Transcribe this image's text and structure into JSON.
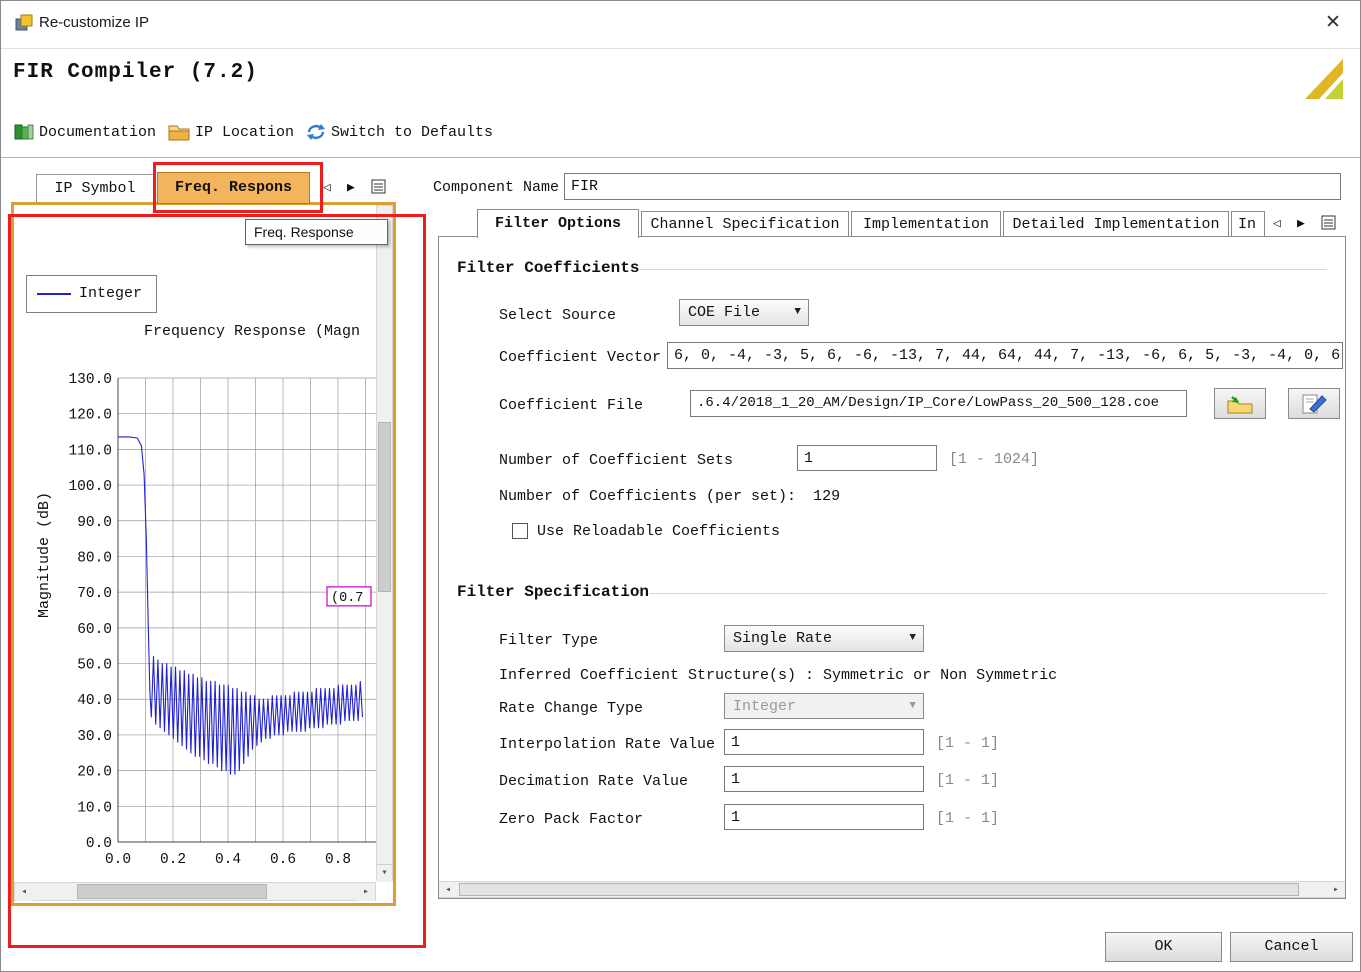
{
  "window": {
    "title": "Re-customize IP",
    "close_glyph": "✕"
  },
  "header": {
    "title": "FIR Compiler  (7.2)"
  },
  "toolbar": {
    "items": [
      {
        "label": "Documentation"
      },
      {
        "label": "IP Location"
      },
      {
        "label": "Switch to Defaults"
      }
    ]
  },
  "left_panel": {
    "tabs": [
      {
        "label": "IP Symbol",
        "selected": false
      },
      {
        "label": "Freq. Respons",
        "selected": true
      }
    ],
    "nav": {
      "prev": "◁",
      "next": "▶"
    },
    "tooltip": "Freq. Response",
    "chart_data": {
      "type": "line",
      "title": "Frequency Response (Magnitude)",
      "title_visible": "Frequency Response (Magn",
      "xlabel": "",
      "ylabel": "Magnitude (dB)",
      "legend": [
        "Integer"
      ],
      "legend_position": "top-left",
      "grid": true,
      "xlim": [
        0.0,
        0.91
      ],
      "ylim": [
        0.0,
        130.0
      ],
      "xticks": [
        0.0,
        0.2,
        0.4,
        0.6,
        0.8
      ],
      "yticks": [
        0,
        10,
        20,
        30,
        40,
        50,
        60,
        70,
        80,
        90,
        100,
        110,
        120,
        130
      ],
      "x_grid_step": 0.1,
      "annotation": {
        "text": "(0.7",
        "x": 0.76,
        "y": 67
      },
      "series": [
        {
          "name": "Integer",
          "color": "#2121d4",
          "points": [
            [
              0,
              113.5
            ],
            [
              0.04,
              113.5
            ],
            [
              0.07,
              113.2
            ],
            [
              0.085,
              111
            ],
            [
              0.095,
              103
            ],
            [
              0.103,
              85
            ],
            [
              0.11,
              60
            ],
            [
              0.116,
              42
            ],
            [
              0.121,
              35
            ],
            [
              0.129,
              52
            ],
            [
              0.137,
              33
            ],
            [
              0.145,
              51
            ],
            [
              0.153,
              32
            ],
            [
              0.161,
              50
            ],
            [
              0.169,
              31
            ],
            [
              0.177,
              50
            ],
            [
              0.185,
              30
            ],
            [
              0.193,
              49
            ],
            [
              0.201,
              29
            ],
            [
              0.209,
              49
            ],
            [
              0.217,
              28
            ],
            [
              0.225,
              48
            ],
            [
              0.233,
              27
            ],
            [
              0.241,
              48
            ],
            [
              0.249,
              26
            ],
            [
              0.257,
              47
            ],
            [
              0.265,
              25
            ],
            [
              0.273,
              47
            ],
            [
              0.281,
              24
            ],
            [
              0.289,
              46
            ],
            [
              0.297,
              24
            ],
            [
              0.305,
              46
            ],
            [
              0.313,
              23
            ],
            [
              0.321,
              45
            ],
            [
              0.329,
              22
            ],
            [
              0.337,
              45
            ],
            [
              0.345,
              22
            ],
            [
              0.353,
              45
            ],
            [
              0.361,
              21
            ],
            [
              0.369,
              44
            ],
            [
              0.377,
              20
            ],
            [
              0.385,
              44
            ],
            [
              0.393,
              20
            ],
            [
              0.401,
              44
            ],
            [
              0.409,
              19
            ],
            [
              0.417,
              43
            ],
            [
              0.425,
              19
            ],
            [
              0.433,
              43
            ],
            [
              0.441,
              20
            ],
            [
              0.449,
              42
            ],
            [
              0.457,
              22
            ],
            [
              0.465,
              42
            ],
            [
              0.473,
              24
            ],
            [
              0.481,
              41
            ],
            [
              0.489,
              26
            ],
            [
              0.497,
              41
            ],
            [
              0.505,
              27
            ],
            [
              0.513,
              40
            ],
            [
              0.521,
              28
            ],
            [
              0.529,
              40
            ],
            [
              0.537,
              29
            ],
            [
              0.545,
              40
            ],
            [
              0.553,
              29
            ],
            [
              0.561,
              41
            ],
            [
              0.569,
              30
            ],
            [
              0.577,
              41
            ],
            [
              0.585,
              30
            ],
            [
              0.593,
              41
            ],
            [
              0.601,
              30
            ],
            [
              0.609,
              41
            ],
            [
              0.617,
              31
            ],
            [
              0.625,
              41
            ],
            [
              0.633,
              31
            ],
            [
              0.641,
              42
            ],
            [
              0.649,
              31
            ],
            [
              0.657,
              42
            ],
            [
              0.665,
              31
            ],
            [
              0.673,
              42
            ],
            [
              0.681,
              31
            ],
            [
              0.689,
              42
            ],
            [
              0.697,
              32
            ],
            [
              0.705,
              42
            ],
            [
              0.713,
              32
            ],
            [
              0.721,
              43
            ],
            [
              0.729,
              32
            ],
            [
              0.737,
              43
            ],
            [
              0.745,
              32
            ],
            [
              0.753,
              43
            ],
            [
              0.761,
              33
            ],
            [
              0.769,
              43
            ],
            [
              0.777,
              33
            ],
            [
              0.785,
              43
            ],
            [
              0.793,
              33
            ],
            [
              0.801,
              44
            ],
            [
              0.809,
              33
            ],
            [
              0.817,
              44
            ],
            [
              0.825,
              34
            ],
            [
              0.833,
              44
            ],
            [
              0.841,
              34
            ],
            [
              0.849,
              44
            ],
            [
              0.857,
              34
            ],
            [
              0.865,
              44
            ],
            [
              0.873,
              34
            ],
            [
              0.881,
              45
            ],
            [
              0.889,
              35
            ]
          ]
        }
      ]
    }
  },
  "component": {
    "label": "Component Name",
    "value": "FIR"
  },
  "right_tabs": [
    {
      "label": "Filter Options",
      "selected": true
    },
    {
      "label": "Channel Specification",
      "selected": false
    },
    {
      "label": "Implementation",
      "selected": false
    },
    {
      "label": "Detailed Implementation",
      "selected": false
    },
    {
      "label": "In",
      "selected": false
    }
  ],
  "right_nav": {
    "prev": "◁",
    "next": "▶"
  },
  "filter_coefficients": {
    "title": "Filter Coefficients",
    "select_source_label": "Select Source",
    "select_source_value": "COE File",
    "coefficient_vector_label": "Coefficient Vector",
    "coefficient_vector_value": "6, 0, -4, -3, 5, 6, -6, -13, 7, 44, 64, 44, 7, -13, -6, 6, 5, -3, -4, 0, 6",
    "coefficient_file_label": "Coefficient File",
    "coefficient_file_value": ".6.4/2018_1_20_AM/Design/IP_Core/LowPass_20_500_128.coe",
    "num_sets_label": "Number of Coefficient Sets",
    "num_sets_value": "1",
    "num_sets_range": "[1 - 1024]",
    "num_coeffs_label": "Number of Coefficients (per set):",
    "num_coeffs_value": "129",
    "reloadable_label": "Use Reloadable Coefficients",
    "reloadable_checked": false
  },
  "filter_specification": {
    "title": "Filter Specification",
    "filter_type_label": "Filter Type",
    "filter_type_value": "Single Rate",
    "inferred_text": "Inferred Coefficient Structure(s) : Symmetric or Non Symmetric",
    "rate_change_label": "Rate Change Type",
    "rate_change_value": "Integer",
    "interp_label": "Interpolation Rate Value",
    "interp_value": "1",
    "interp_range": "[1 - 1]",
    "decim_label": "Decimation Rate Value",
    "decim_value": "1",
    "decim_range": "[1 - 1]",
    "zero_pack_label": "Zero Pack Factor",
    "zero_pack_value": "1",
    "zero_pack_range": "[1 - 1]"
  },
  "footer": {
    "ok": "OK",
    "cancel": "Cancel"
  },
  "colors": {
    "panel_border": "#dc9f35",
    "tab_selected_bg": "#f2b45c",
    "annotation_red": "#ee1c1c",
    "curve_blue": "#2121d4",
    "marker_magenta": "#c800c8"
  }
}
